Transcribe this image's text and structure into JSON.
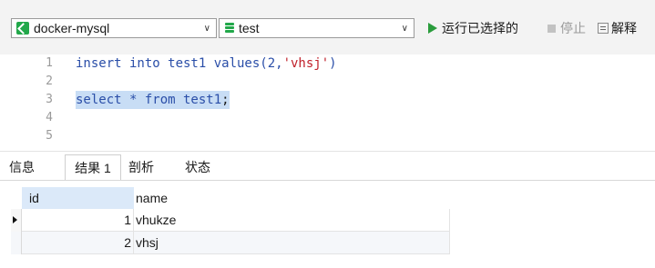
{
  "toolbar": {
    "connection": "docker-mysql",
    "database": "test",
    "run_selected_label": "运行已选择的",
    "stop_label": "停止",
    "explain_label": "解释"
  },
  "editor": {
    "lines": [
      {
        "no": "1",
        "keyword": "insert into test1 values(2,",
        "string": "'vhsj'",
        "tail": ")"
      },
      {
        "no": "2"
      },
      {
        "no": "3",
        "keyword": "select * from test1",
        "tail": ";"
      },
      {
        "no": "4"
      },
      {
        "no": "5"
      }
    ]
  },
  "result_tabs": [
    {
      "label": "信息"
    },
    {
      "label": "结果 1",
      "active": true
    },
    {
      "label": "剖析"
    },
    {
      "label": "状态"
    }
  ],
  "grid": {
    "columns": [
      "id",
      "name"
    ],
    "rows": [
      {
        "id": "1",
        "name": "vhukze",
        "current": true
      },
      {
        "id": "2",
        "name": "vhsj",
        "current": false
      }
    ]
  },
  "colors": {
    "keyword": "#2a4ea8",
    "string": "#c0202a",
    "selection": "#c8ddf5",
    "run_icon": "#2a9c3c",
    "connection_icon": "#22a84a"
  }
}
